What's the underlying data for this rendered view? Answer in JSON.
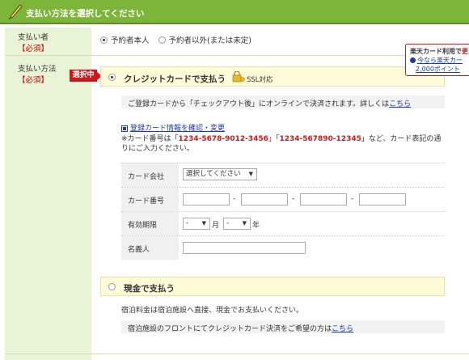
{
  "header": {
    "title": "支払い方法を選択してください"
  },
  "payer": {
    "label": "支払い者",
    "required": "【必須】",
    "options": [
      "予約者本人",
      "予約者以外(または未定)"
    ]
  },
  "method": {
    "label": "支払い方法",
    "required": "【必須】",
    "selected_badge": "選択中"
  },
  "credit": {
    "label": "クレジットカードで支払う",
    "ssl": "SSL対応",
    "info_text": "ご登録カードから「チェックアウト後」にオンラインで決済されます。詳しくは",
    "info_link": "こちら",
    "confirm_link": "登録カード情報を確認・変更",
    "note_prefix": "※カード番号は「",
    "note_num1": "1234-5678-9012-3456",
    "note_mid": "」「",
    "note_num2": "1234-567890-12345",
    "note_suffix": "」など、カード表記の通りにご入力ください。",
    "fields": {
      "company_label": "カード会社",
      "company_value": "選択してください",
      "number_label": "カード番号",
      "number_sep": "-",
      "expiry_label": "有効期限",
      "expiry_month": "-",
      "month_unit": "月",
      "expiry_year": "-",
      "year_unit": "年",
      "name_label": "名義人"
    }
  },
  "cash": {
    "label": "現金で支払う",
    "text": "宿泊料金は宿泊施設へ直接、現金でお支払いください。",
    "bar_text": "宿泊施設のフロントにてクレジットカード決済をご希望の方は",
    "bar_link": "こちら"
  },
  "popup": {
    "line1": "楽天カード利用で",
    "line1_red": "更",
    "line2": "今なら楽天カー",
    "line3": "2,000ポイント"
  },
  "colors": {
    "accent": "#7db43a",
    "badge": "#c8191d",
    "link": "#1d3aa8",
    "highlight": "#fffbd8"
  }
}
